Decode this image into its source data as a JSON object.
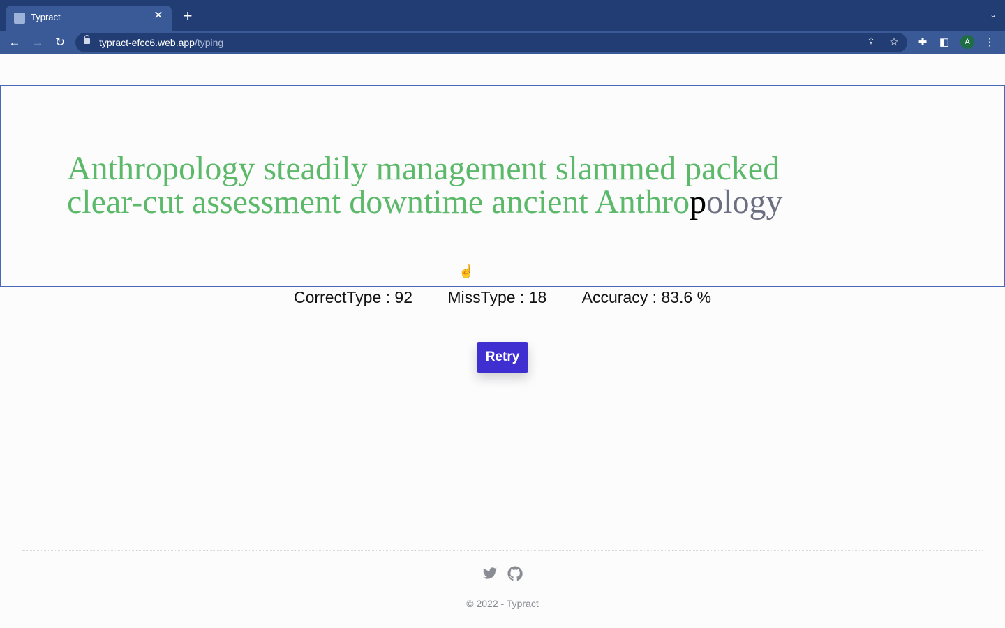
{
  "browser": {
    "tab_title": "Typract",
    "new_tab_label": "+",
    "url_host": "typract-efcc6.web.app",
    "url_path": "/typing",
    "profile_initial": "A"
  },
  "typing": {
    "line1_typed": "Anthropology steadily management slammed packed",
    "line2_typed": "clear-cut assessment downtime ancient Anthro",
    "current_char": "p",
    "remaining": "ology"
  },
  "stats": {
    "correct": "CorrectType : 92",
    "miss": "MissType : 18",
    "accuracy": "Accuracy : 83.6 %"
  },
  "retry_label": "Retry",
  "footer": {
    "copyright": "© 2022 - Typract",
    "icons": [
      "twitter-icon",
      "github-icon"
    ]
  },
  "colors": {
    "typed": "#5cb96a",
    "remaining": "#6b6f80",
    "retry_bg": "#3f2fd0",
    "chrome_dark": "#213d73",
    "chrome_light": "#3a5a97"
  }
}
